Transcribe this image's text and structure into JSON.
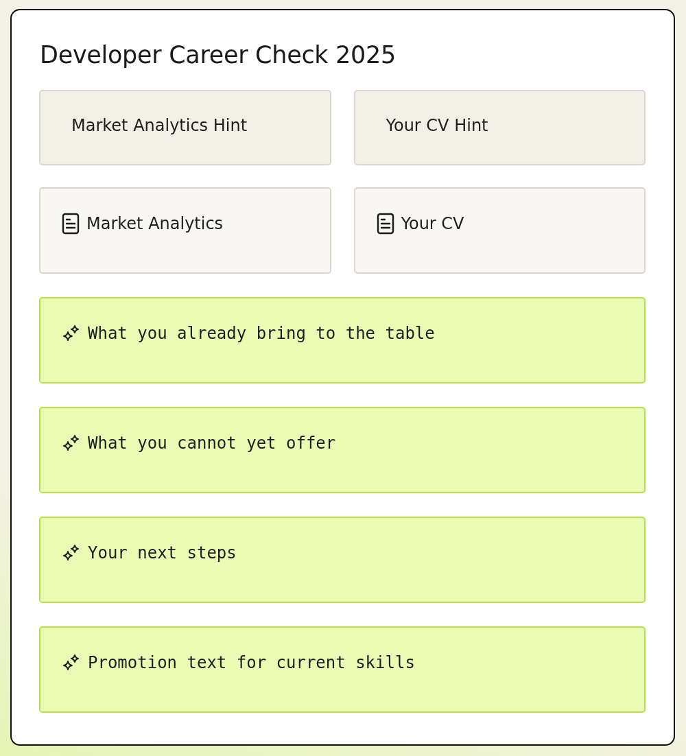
{
  "title": "Developer Career Check 2025",
  "hints": [
    {
      "label": "Market Analytics Hint"
    },
    {
      "label": "Your CV Hint"
    }
  ],
  "documents": [
    {
      "label": "Market Analytics"
    },
    {
      "label": "Your CV"
    }
  ],
  "actions": [
    {
      "label": "What you already bring to the table"
    },
    {
      "label": "What you cannot yet offer"
    },
    {
      "label": "Your next steps"
    },
    {
      "label": "Promotion text for current skills"
    }
  ]
}
